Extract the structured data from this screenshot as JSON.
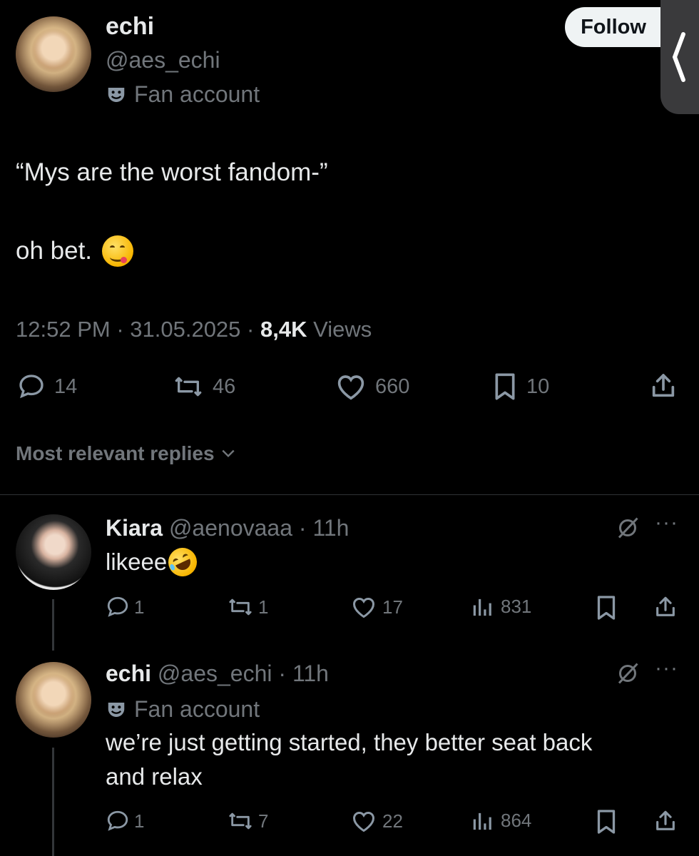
{
  "main_tweet": {
    "display_name": "echi",
    "handle": "@aes_echi",
    "badge_label": "Fan account",
    "text_line1": "“Mys are the worst fandom-”",
    "text_line2": "oh bet.",
    "emoji": "yum-face",
    "time": "12:52 PM",
    "date": "31.05.2025",
    "views_count": "8,4K",
    "views_label": "Views",
    "replies": "14",
    "reposts": "46",
    "likes": "660",
    "bookmarks": "10"
  },
  "follow_label": "Follow",
  "replies_sort_label": "Most relevant replies",
  "replies": [
    {
      "display_name": "Kiara",
      "handle": "@aenovaaa",
      "age": "11h",
      "text": "likeee",
      "emoji": "rolling-laughing-face",
      "replies": "1",
      "reposts": "1",
      "likes": "17",
      "views": "831"
    },
    {
      "display_name": "echi",
      "handle": "@aes_echi",
      "age": "11h",
      "badge_label": "Fan account",
      "text_line1": "we’re just getting started, they better seat back",
      "text_line2": "and relax",
      "replies": "1",
      "reposts": "7",
      "likes": "22",
      "views": "864"
    }
  ]
}
